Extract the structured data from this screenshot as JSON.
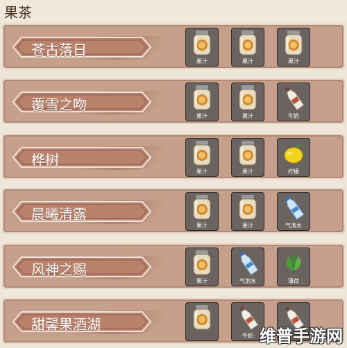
{
  "header": {
    "title": "果茶"
  },
  "recipes": [
    {
      "name": "苍古落日",
      "ingredients": [
        {
          "label": "果汁",
          "icon": "juice-jar-icon"
        },
        {
          "label": "果汁",
          "icon": "juice-jar-icon"
        },
        {
          "label": "果汁",
          "icon": "juice-jar-icon"
        }
      ]
    },
    {
      "name": "覆雪之吻",
      "ingredients": [
        {
          "label": "果汁",
          "icon": "juice-jar-icon"
        },
        {
          "label": "果汁",
          "icon": "juice-jar-icon"
        },
        {
          "label": "牛奶",
          "icon": "milk-bottle-icon"
        }
      ]
    },
    {
      "name": "桦树",
      "ingredients": [
        {
          "label": "果汁",
          "icon": "juice-jar-icon"
        },
        {
          "label": "果汁",
          "icon": "juice-jar-icon"
        },
        {
          "label": "柠檬",
          "icon": "lemon-icon"
        }
      ]
    },
    {
      "name": "晨曦清露",
      "ingredients": [
        {
          "label": "果汁",
          "icon": "juice-jar-icon"
        },
        {
          "label": "果汁",
          "icon": "juice-jar-icon"
        },
        {
          "label": "气泡水",
          "icon": "soda-bottle-icon"
        }
      ]
    },
    {
      "name": "风神之赐",
      "ingredients": [
        {
          "label": "果汁",
          "icon": "juice-jar-icon"
        },
        {
          "label": "气泡水",
          "icon": "soda-bottle-icon"
        },
        {
          "label": "薄荷",
          "icon": "mint-icon"
        }
      ]
    },
    {
      "name": "甜馨果酒湖",
      "ingredients": [
        {
          "label": "",
          "icon": "juice-jar-icon"
        },
        {
          "label": "牛奶",
          "icon": "milk-bottle-icon"
        },
        {
          "label": "",
          "icon": "milk-bottle-icon"
        }
      ]
    }
  ],
  "watermark": {
    "text": "维普手游网"
  },
  "colors": {
    "row_bg": "#c6a08a",
    "slot_bg": "#6a6360",
    "banner": "#b9826d"
  }
}
